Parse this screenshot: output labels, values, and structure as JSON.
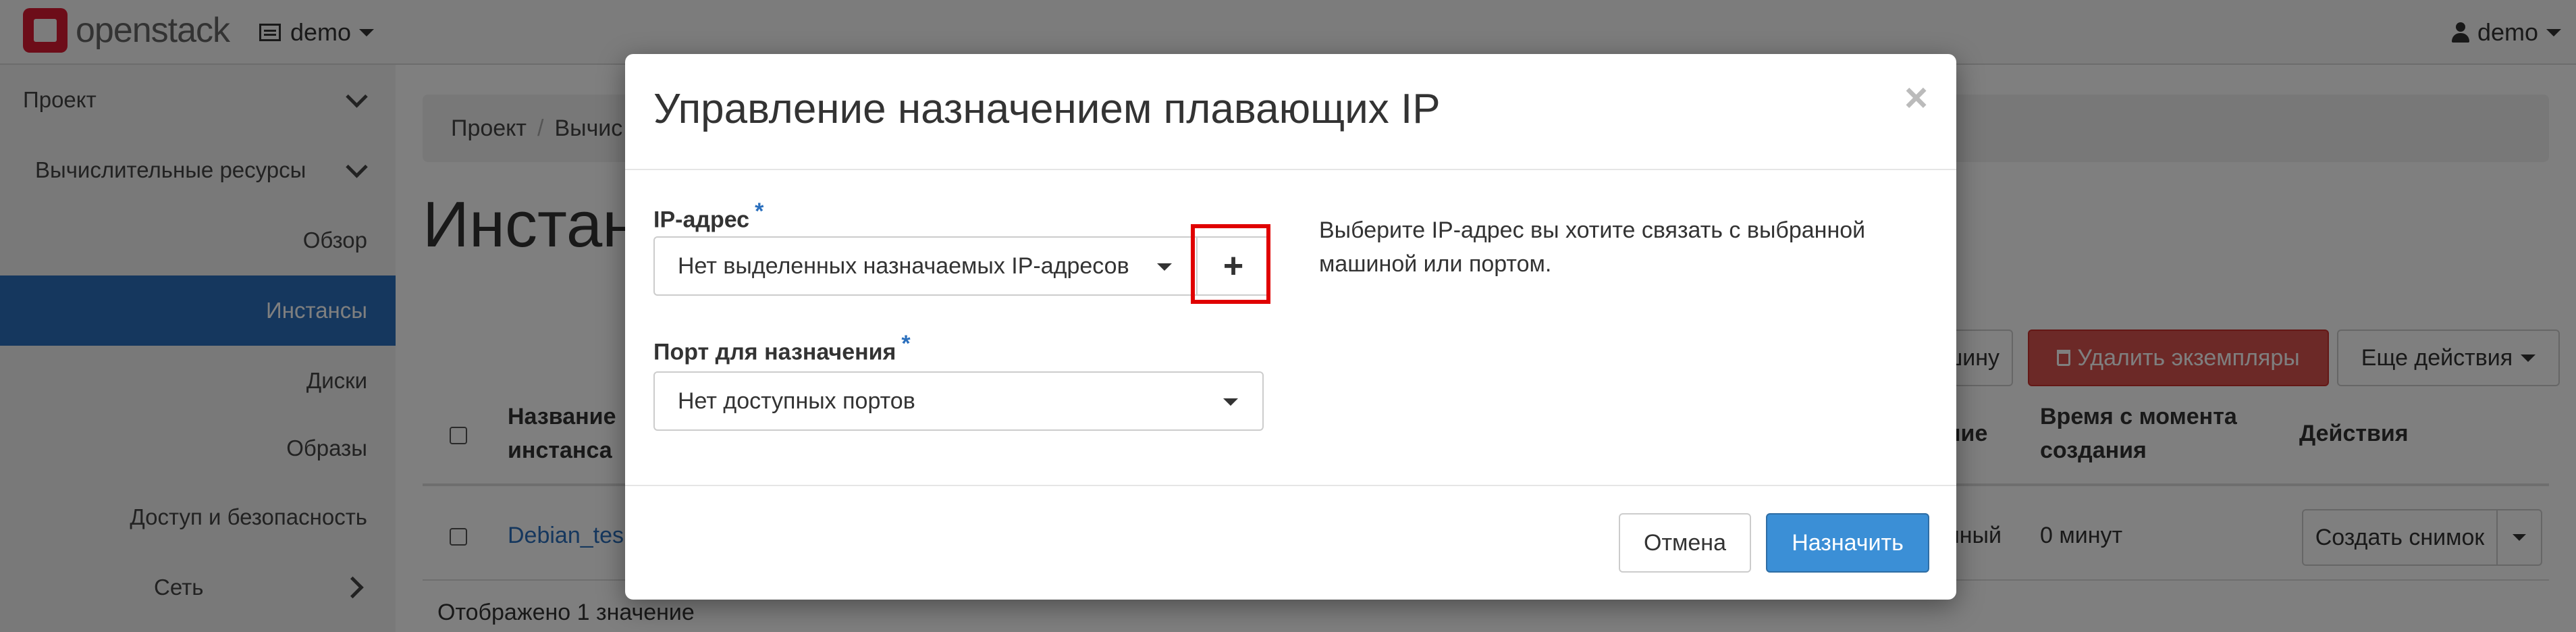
{
  "navbar": {
    "brand": "openstack",
    "project": "demo",
    "user": "demo"
  },
  "sidebar": {
    "items": [
      {
        "label": "Проект"
      },
      {
        "label": "Вычислительные ресурсы"
      },
      {
        "label": "Обзор"
      },
      {
        "label": "Инстансы"
      },
      {
        "label": "Диски"
      },
      {
        "label": "Образы"
      },
      {
        "label": "Доступ и безопасность"
      },
      {
        "label": "Сеть"
      }
    ]
  },
  "breadcrumb": {
    "item1": "Проект",
    "separator": "/",
    "item2": "Вычис"
  },
  "page": {
    "title": "Инстан"
  },
  "toolbar": {
    "launch_partial": "шину",
    "delete_instances": "Удалить экземпляры",
    "more_actions": "Еще действия"
  },
  "table": {
    "headers": {
      "name_line1": "Название",
      "name_line2": "инстанса",
      "status_partial": "ние",
      "time_line1": "Время с момента",
      "time_line2": "создания",
      "actions": "Действия"
    },
    "rows": [
      {
        "name": "Debian_tes",
        "status_partial": "нный",
        "time": "0 минут",
        "action": "Создать снимок"
      }
    ],
    "footer": "Отображено 1 значение"
  },
  "modal": {
    "title": "Управление назначением плавающих IP",
    "close": "×",
    "ip_label": "IP-адрес",
    "required_mark": "*",
    "ip_select_value": "Нет выделенных назначаемых IP-адресов",
    "plus": "+",
    "port_label": "Порт для назначения",
    "port_select_value": "Нет доступных портов",
    "help": "Выберите IP-адрес вы хотите связать с выбранной машиной или портом.",
    "cancel": "Отмена",
    "submit": "Назначить"
  },
  "colors": {
    "primary": "#3b8fd6",
    "sidebar_active": "#2a6fbd",
    "danger": "#d9534f",
    "highlight": "#e00000",
    "logo": "#da1a32"
  }
}
